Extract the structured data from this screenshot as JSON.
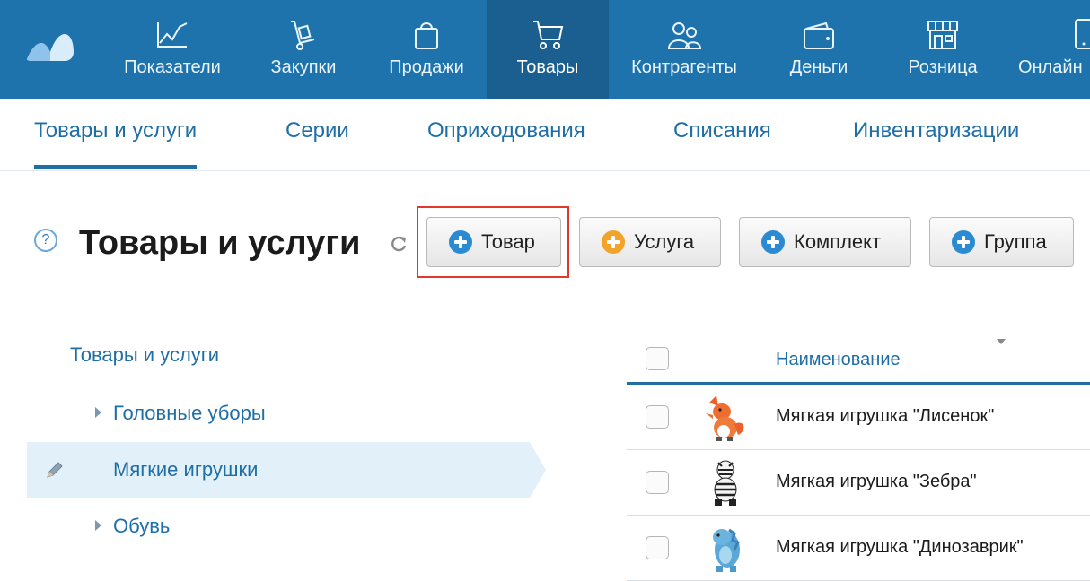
{
  "topnav": {
    "items": [
      {
        "label": "Показатели",
        "icon": "chart-icon"
      },
      {
        "label": "Закупки",
        "icon": "hand-truck-icon"
      },
      {
        "label": "Продажи",
        "icon": "shopping-bag-icon"
      },
      {
        "label": "Товары",
        "icon": "cart-icon",
        "active": true
      },
      {
        "label": "Контрагенты",
        "icon": "people-icon"
      },
      {
        "label": "Деньги",
        "icon": "wallet-icon"
      },
      {
        "label": "Розница",
        "icon": "store-icon"
      },
      {
        "label": "Онлайн",
        "icon": "phone-icon"
      }
    ]
  },
  "subtabs": [
    "Товары и услуги",
    "Серии",
    "Оприходования",
    "Списания",
    "Инвентаризации"
  ],
  "header": {
    "title": "Товары и услуги",
    "buttons": {
      "product": "Товар",
      "service": "Услуга",
      "bundle": "Комплект",
      "group": "Группа"
    }
  },
  "tree": {
    "root": "Товары и услуги",
    "items": [
      "Головные уборы",
      "Мягкие игрушки",
      "Обувь"
    ]
  },
  "table": {
    "column_name": "Наименование",
    "rows": [
      {
        "name": "Мягкая игрушка \"Лисенок\"",
        "thumb": "fox-toy"
      },
      {
        "name": "Мягкая игрушка \"Зебра\"",
        "thumb": "zebra-toy"
      },
      {
        "name": "Мягкая игрушка \"Динозаврик\"",
        "thumb": "dinosaur-toy"
      }
    ]
  },
  "colors": {
    "nav_bg": "#1e73ad",
    "nav_active_bg": "#1a5f8f",
    "link": "#1f6ea6",
    "highlight": "#e03a2a",
    "plus_blue": "#2a8ad2",
    "plus_orange": "#f2a32a"
  }
}
